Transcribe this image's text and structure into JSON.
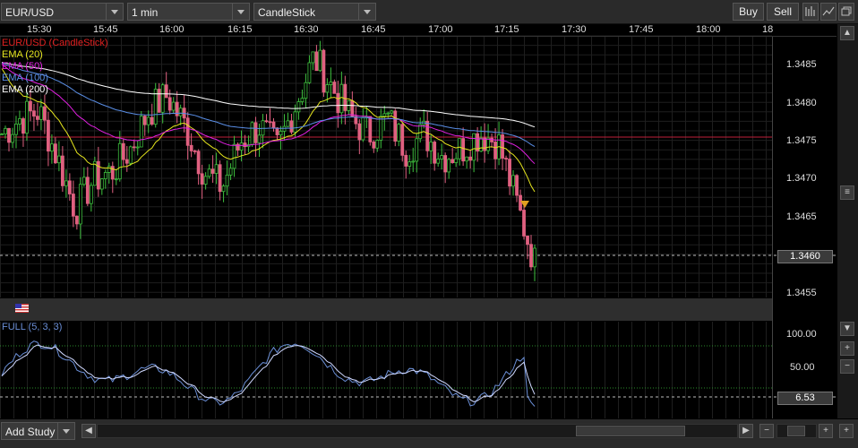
{
  "toolbar": {
    "symbol": "EUR/USD",
    "interval": "1 min",
    "chart_type": "CandleStick",
    "buy_label": "Buy",
    "sell_label": "Sell"
  },
  "time_axis": {
    "labels": [
      "15:30",
      "15:45",
      "16:00",
      "16:15",
      "16:30",
      "16:45",
      "17:00",
      "17:15",
      "17:30",
      "17:45",
      "18:00",
      "18"
    ]
  },
  "price_axis": {
    "labels": [
      "1.3485",
      "1.3480",
      "1.3475",
      "1.3470",
      "1.3465",
      "1.3455"
    ],
    "current_price": "1.3460"
  },
  "legend": {
    "series": [
      {
        "label": "EUR/USD (CandleStick)",
        "color": "#e02020"
      },
      {
        "label": "EMA (20)",
        "color": "#e6e61e"
      },
      {
        "label": "EMA (50)",
        "color": "#e020e0"
      },
      {
        "label": "EMA (100)",
        "color": "#5a8ee6"
      },
      {
        "label": "EMA (200)",
        "color": "#ffffff"
      }
    ]
  },
  "oscillator": {
    "label": "FULL (5, 3, 3)",
    "axis_labels": [
      "100.00",
      "50.00"
    ],
    "current_value": "6.53"
  },
  "bottom": {
    "add_study_label": "Add Study"
  },
  "icons": {
    "flag": "us-flag-icon",
    "indicator": "bars-icon",
    "restore": "restore-icon"
  }
}
